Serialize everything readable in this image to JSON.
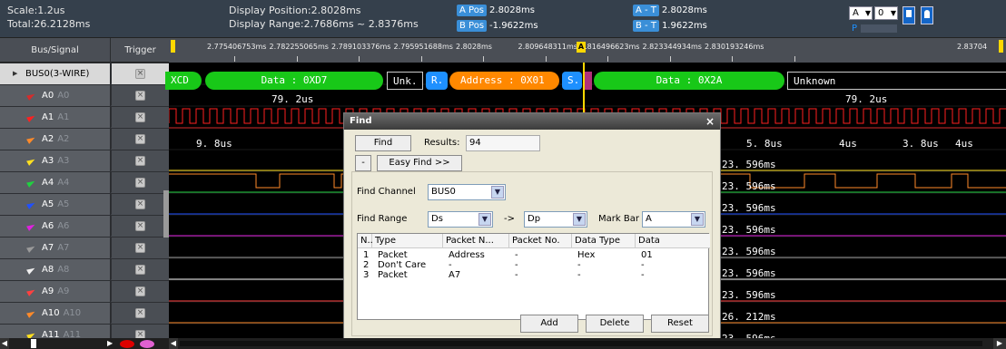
{
  "topbar": {
    "scale": "Scale:1.2us",
    "total": "Total:26.2128ms",
    "display_position": "Display Position:2.8028ms",
    "display_range": "Display Range:2.7686ms ~ 2.8376ms",
    "cursors": [
      {
        "label": "A Pos",
        "value": "2.8028ms"
      },
      {
        "label": "B Pos",
        "value": "-1.9622ms"
      },
      {
        "label": "A - T",
        "value": "2.8028ms"
      },
      {
        "label": "B - T",
        "value": "1.9622ms"
      }
    ],
    "sel1": "A",
    "sel2": "0",
    "marker_p": "P"
  },
  "header": {
    "bus_signal": "Bus/Signal",
    "trigger": "Trigger"
  },
  "channels": [
    {
      "name": "BUS0(3-WIRE)",
      "ghost": "",
      "color": "#ffffff"
    },
    {
      "name": "A0",
      "ghost": "A0",
      "color": "#d42c2c"
    },
    {
      "name": "A1",
      "ghost": "A1",
      "color": "#ff2020"
    },
    {
      "name": "A2",
      "ghost": "A2",
      "color": "#ff8a2a"
    },
    {
      "name": "A3",
      "ghost": "A3",
      "color": "#ffe020"
    },
    {
      "name": "A4",
      "ghost": "A4",
      "color": "#20d040"
    },
    {
      "name": "A5",
      "ghost": "A5",
      "color": "#2050ff"
    },
    {
      "name": "A6",
      "ghost": "A6",
      "color": "#e020e0"
    },
    {
      "name": "A7",
      "ghost": "A7",
      "color": "#9a9a9a"
    },
    {
      "name": "A8",
      "ghost": "A8",
      "color": "#f0f0f0"
    },
    {
      "name": "A9",
      "ghost": "A9",
      "color": "#ff4040"
    },
    {
      "name": "A10",
      "ghost": "A10",
      "color": "#ff8a2a"
    },
    {
      "name": "A11",
      "ghost": "A11",
      "color": "#ffe020"
    }
  ],
  "ruler": {
    "ticks": [
      "2.775406753ms",
      "2.782255065ms",
      "2.789103376ms",
      "2.795951688ms",
      "2.8028ms",
      "2.809648311ms",
      "2.816496623ms",
      "2.823344934ms",
      "2.830193246ms",
      "2.83704"
    ],
    "marker_a": "A"
  },
  "bus_segments": [
    {
      "text": "XCD"
    },
    {
      "text": "Data : 0XD7"
    },
    {
      "text": "Unk."
    },
    {
      "text": "R."
    },
    {
      "text": "Address : 0X01"
    },
    {
      "text": "S."
    },
    {
      "text": ""
    },
    {
      "text": "Data : 0X2A"
    },
    {
      "text": "Unknown"
    }
  ],
  "wave_labels": {
    "a0_left": "79. 2us",
    "a0_right": "79. 2us",
    "a2_left": "9. 8us",
    "a2_r1": "5. 8us",
    "a2_r2": "4us",
    "a2_r3": "3. 8us",
    "a2_r4": "4us"
  },
  "right_times": [
    "23. 596ms",
    "23. 596ms",
    "23. 596ms",
    "23. 596ms",
    "23. 596ms",
    "23. 596ms",
    "23. 596ms",
    "26. 212ms",
    "23. 596ms"
  ],
  "find": {
    "title": "Find",
    "close": "×",
    "find_btn": "Find",
    "results_label": "Results:",
    "results_value": "94",
    "minus_btn": "-",
    "easy_find_btn": "Easy Find >>",
    "channel_label": "Find Channel",
    "channel_value": "BUS0",
    "range_label": "Find Range",
    "range_from": "Ds",
    "arrow": "->",
    "range_to": "Dp",
    "markbar_label": "Mark Bar",
    "markbar_value": "A",
    "columns": [
      "N..",
      "Type",
      "Packet N...",
      "Packet No.",
      "Data Type",
      "Data"
    ],
    "rows": [
      [
        "1",
        "Packet",
        "Address",
        "-",
        "Hex",
        "01"
      ],
      [
        "2",
        "Don't Care",
        "-",
        "-",
        "-",
        "-"
      ],
      [
        "3",
        "Packet",
        "A7",
        "-",
        "-",
        "-"
      ]
    ],
    "add_btn": "Add",
    "delete_btn": "Delete",
    "reset_btn": "Reset"
  },
  "colors": {
    "bus_green": "#18c818",
    "bus_orange": "#ff8800",
    "bus_blue": "#1e90ff",
    "cursor_yellow": "#ffd800",
    "accent_blue": "#3a8fd8"
  }
}
